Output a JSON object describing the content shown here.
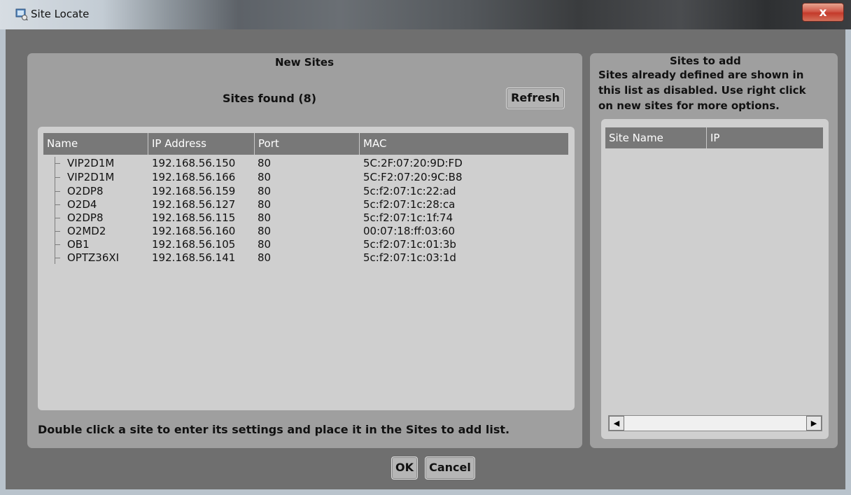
{
  "window": {
    "title": "Site Locate",
    "close_label": "x"
  },
  "left": {
    "section_title": "New Sites",
    "sites_found": "Sites found (8)",
    "refresh_label": "Refresh",
    "columns": [
      "Name",
      "IP Address",
      "Port",
      "MAC"
    ],
    "rows": [
      {
        "name": "VIP2D1M",
        "ip": "192.168.56.150",
        "port": "80",
        "mac": "5C:2F:07:20:9D:FD"
      },
      {
        "name": "VIP2D1M",
        "ip": "192.168.56.166",
        "port": "80",
        "mac": "5C:F2:07:20:9C:B8"
      },
      {
        "name": "O2DP8",
        "ip": "192.168.56.159",
        "port": "80",
        "mac": "5c:f2:07:1c:22:ad"
      },
      {
        "name": "O2D4",
        "ip": "192.168.56.127",
        "port": "80",
        "mac": "5c:f2:07:1c:28:ca"
      },
      {
        "name": "O2DP8",
        "ip": "192.168.56.115",
        "port": "80",
        "mac": "5c:f2:07:1c:1f:74"
      },
      {
        "name": "O2MD2",
        "ip": "192.168.56.160",
        "port": "80",
        "mac": "00:07:18:ff:03:60"
      },
      {
        "name": "OB1",
        "ip": "192.168.56.105",
        "port": "80",
        "mac": "5c:f2:07:1c:01:3b"
      },
      {
        "name": "OPTZ36XI",
        "ip": "192.168.56.141",
        "port": "80",
        "mac": "5c:f2:07:1c:03:1d"
      }
    ],
    "hint": "Double click a site to enter its settings and place it in the Sites to add list."
  },
  "right": {
    "section_title": "Sites to add",
    "description_lines": [
      "Sites already defined are shown in",
      "this list as disabled.  Use right click",
      "on new sites for more options."
    ],
    "columns": [
      "Site Name",
      "IP"
    ],
    "scroll_left": "◀",
    "scroll_right": "▶"
  },
  "buttons": {
    "ok_label": "OK",
    "cancel_label": "Cancel"
  }
}
